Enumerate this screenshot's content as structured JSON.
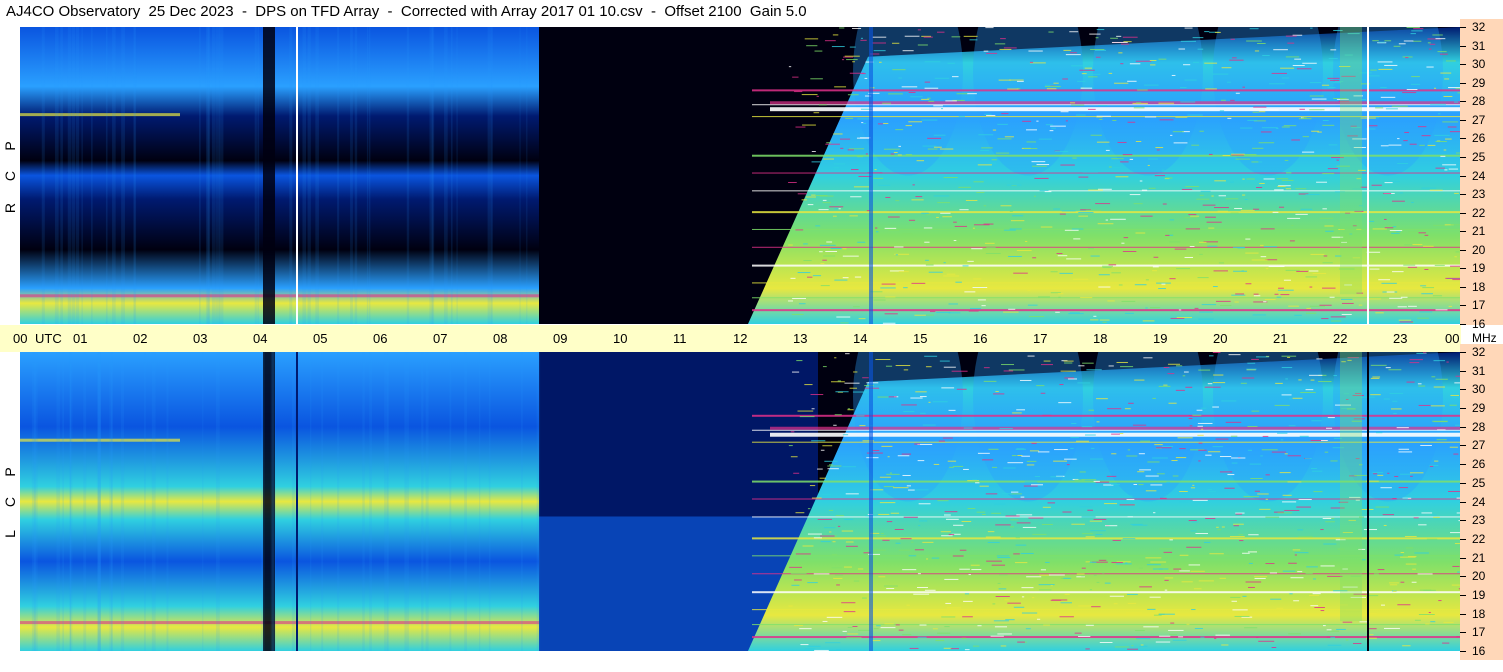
{
  "title": "AJ4CO Observatory  25 Dec 2023  -  DPS on TFD Array  -  Corrected with Array 2017 01 10.csv  -  Offset 2100  Gain 5.0",
  "chart_data": {
    "type": "heatmap",
    "panels": [
      {
        "name": "rcp",
        "letters": [
          "R",
          "C",
          "P"
        ]
      },
      {
        "name": "lcp",
        "letters": [
          "L",
          "C",
          "P"
        ]
      }
    ],
    "x_axis": {
      "unit_label": "UTC",
      "ticks": [
        "00",
        "01",
        "02",
        "03",
        "04",
        "05",
        "06",
        "07",
        "08",
        "09",
        "10",
        "11",
        "12",
        "13",
        "14",
        "15",
        "16",
        "17",
        "18",
        "19",
        "20",
        "21",
        "22",
        "23",
        "00"
      ],
      "range": [
        0,
        24
      ]
    },
    "y_axis": {
      "unit_label": "MHz",
      "ticks": [
        "32",
        "31",
        "30",
        "29",
        "28",
        "27",
        "26",
        "25",
        "24",
        "23",
        "22",
        "21",
        "20",
        "19",
        "18",
        "17",
        "16"
      ],
      "range": [
        16,
        32
      ]
    },
    "colors": {
      "black": "#000010",
      "dark_blue": "#001a70",
      "blue": "#0a55e0",
      "light_blue": "#2aa0ff",
      "cyan": "#30d0e0",
      "green": "#7ee06a",
      "yellow": "#e8e840",
      "magenta": "#e0308a",
      "white": "#ffffff",
      "axis_bg": "#ffffc8",
      "freq_bg": "#ffd7b8"
    }
  }
}
